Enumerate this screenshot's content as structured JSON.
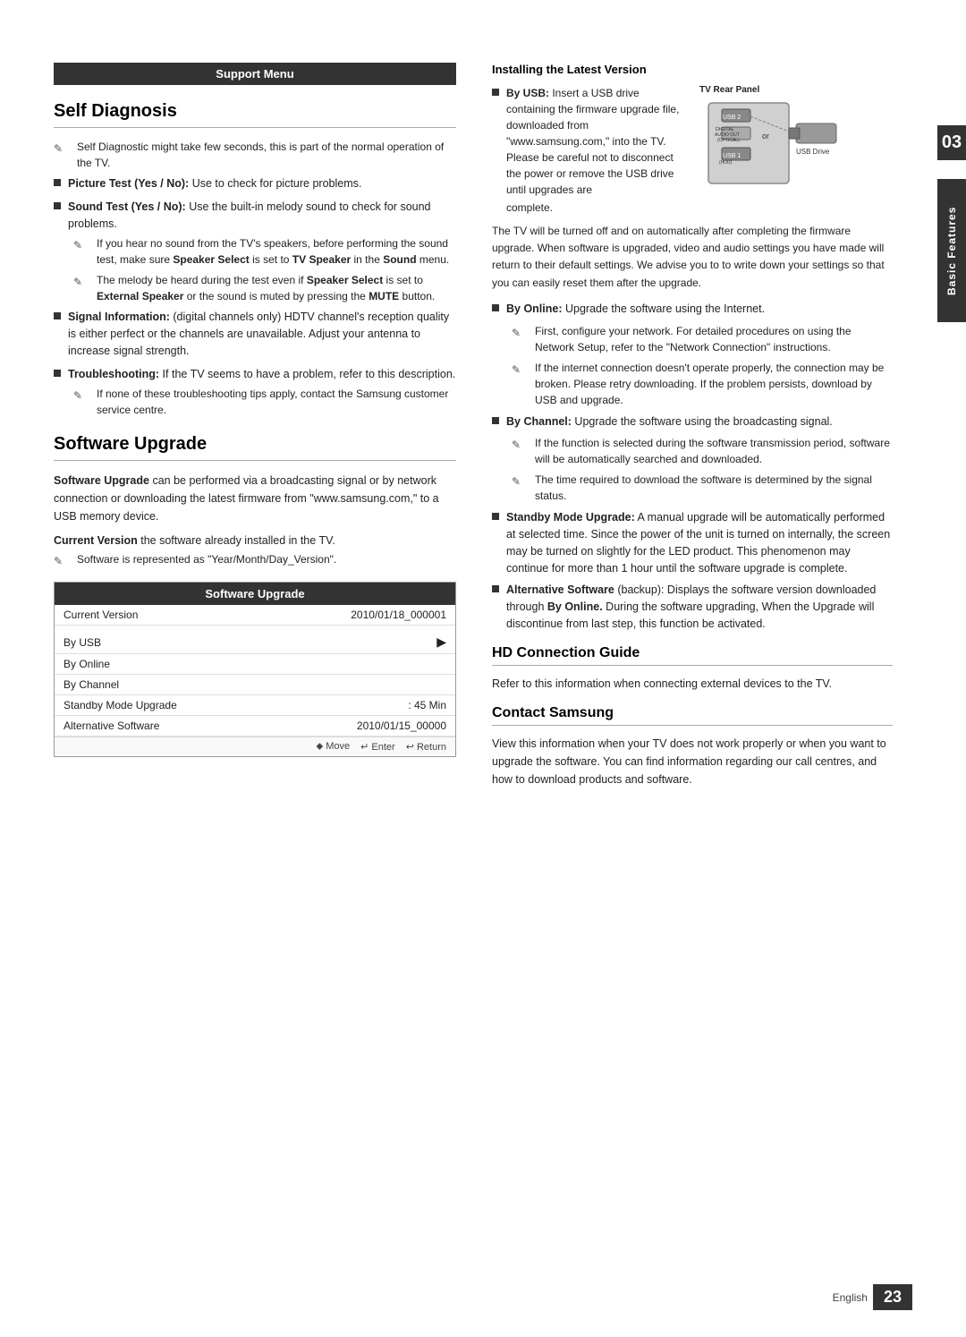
{
  "page": {
    "number": "23",
    "language": "English",
    "chapter": "03",
    "chapter_label": "Basic Features"
  },
  "header": {
    "support_menu": "Support Menu"
  },
  "left": {
    "self_diagnosis": {
      "title": "Self Diagnosis",
      "intro_note": "Self Diagnostic might take few seconds, this is part of the normal operation of the TV.",
      "items": [
        {
          "type": "square",
          "text": "Picture Test (Yes / No): Use to check for picture problems.",
          "bold_parts": [
            "Picture Test (Yes / No):"
          ]
        },
        {
          "type": "square",
          "text": "Sound Test (Yes / No): Use the built-in melody sound to check for sound problems.",
          "bold_parts": [
            "Sound Test (Yes / No):"
          ],
          "subnotes": [
            "If you hear no sound from the TV's speakers, before performing the sound test, make sure Speaker Select is set to TV Speaker in the Sound menu.",
            "The melody will be heard during the test even if Speaker Select is set to External Speaker or the sound is muted by pressing the MUTE button."
          ],
          "subnotes_bold": [
            [
              "Speaker Select",
              "TV Speaker",
              "Sound"
            ],
            [
              "Speaker Select",
              "External Speaker",
              "MUTE"
            ]
          ]
        },
        {
          "type": "square",
          "text": "Signal Information: (digital channels only) HDTV channel's reception quality is either perfect or the channels are unavailable. Adjust your antenna to increase signal strength.",
          "bold_parts": [
            "Signal Information:"
          ]
        },
        {
          "type": "square",
          "text": "Troubleshooting: If the TV seems to have a problem, refer to this description.",
          "bold_parts": [
            "Troubleshooting:"
          ],
          "subnotes": [
            "If none of these troubleshooting tips apply, contact the Samsung customer service centre."
          ],
          "subnotes_bold": []
        }
      ]
    },
    "software_upgrade": {
      "title": "Software Upgrade",
      "intro": "Software Upgrade can be performed via a broadcasting signal or by network connection or downloading the latest firmware from \"www.samsung.com,\" to a USB memory device.",
      "intro_bold": [
        "Software Upgrade"
      ],
      "current_version_label": "Current Version the software already installed in the TV.",
      "current_version_bold": [
        "Current Version"
      ],
      "note": "Software is represented as \"Year/Month/Day_Version\".",
      "box": {
        "header": "Software Upgrade",
        "rows": [
          {
            "label": "Current Version",
            "value": "2010/01/18_000001"
          },
          {
            "label": "By USB",
            "value": "▶",
            "arrow": true
          },
          {
            "label": "By Online",
            "value": ""
          },
          {
            "label": "By Channel",
            "value": ""
          },
          {
            "label": "Standby Mode Upgrade",
            "value": ": 45 Min"
          },
          {
            "label": "Alternative Software",
            "value": "2010/01/15_00000"
          }
        ],
        "nav": {
          "move": "Move",
          "enter": "Enter",
          "return": "Return"
        }
      }
    }
  },
  "right": {
    "installing_latest": {
      "title": "Installing the Latest Version",
      "by_usb": {
        "label": "By USB:",
        "text": "Insert a USB drive containing the firmware upgrade file, downloaded from \"www.samsung.com,\" into the TV. Please be careful not to disconnect the power or remove the USB drive until upgrades are complete.",
        "tv_rear_panel_label": "TV Rear Panel",
        "usb_drive_label": "USB Drive"
      },
      "post_text": "The TV will be turned off and on automatically after completing the firmware upgrade. When software is upgraded, video and audio settings you have made will return to their default settings. We advise you to to write down your settings so that you can easily reset them after the upgrade."
    },
    "by_online": {
      "label": "By Online:",
      "text": "Upgrade the software using the Internet.",
      "notes": [
        "First, configure your network. For detailed procedures on using the Network Setup, refer to the \"Network Connection\" instructions.",
        "If the internet connection doesn't operate properly, the connection may be broken. Please retry downloading. If the problem persists, download by USB and upgrade."
      ]
    },
    "by_channel": {
      "label": "By Channel:",
      "text": "Upgrade the software using the broadcasting signal.",
      "notes": [
        "If the function is selected during the software transmission period, software will be automatically searched and downloaded.",
        "The time required to download the software is determined by the signal status."
      ]
    },
    "standby_mode": {
      "label": "Standby Mode Upgrade:",
      "text": "A manual upgrade will be automatically performed at selected time. Since the power of the unit is turned on internally, the screen may be turned on slightly for the LED product. This phenomenon may continue for more than 1 hour until the software upgrade is complete."
    },
    "alternative_software": {
      "label": "Alternative Software",
      "text": "(backup): Displays the software version downloaded through By Online. During the software upgrading, When the Upgrade will discontinue from last step, this function be activated.",
      "bold_parts": [
        "By Online."
      ]
    },
    "hd_connection": {
      "title": "HD Connection Guide",
      "text": "Refer to this information when connecting external devices to the TV."
    },
    "contact_samsung": {
      "title": "Contact Samsung",
      "text": "View this information when your TV does not work properly or when you want to upgrade the software. You can find information regarding our call centres, and how to download products and software."
    }
  }
}
